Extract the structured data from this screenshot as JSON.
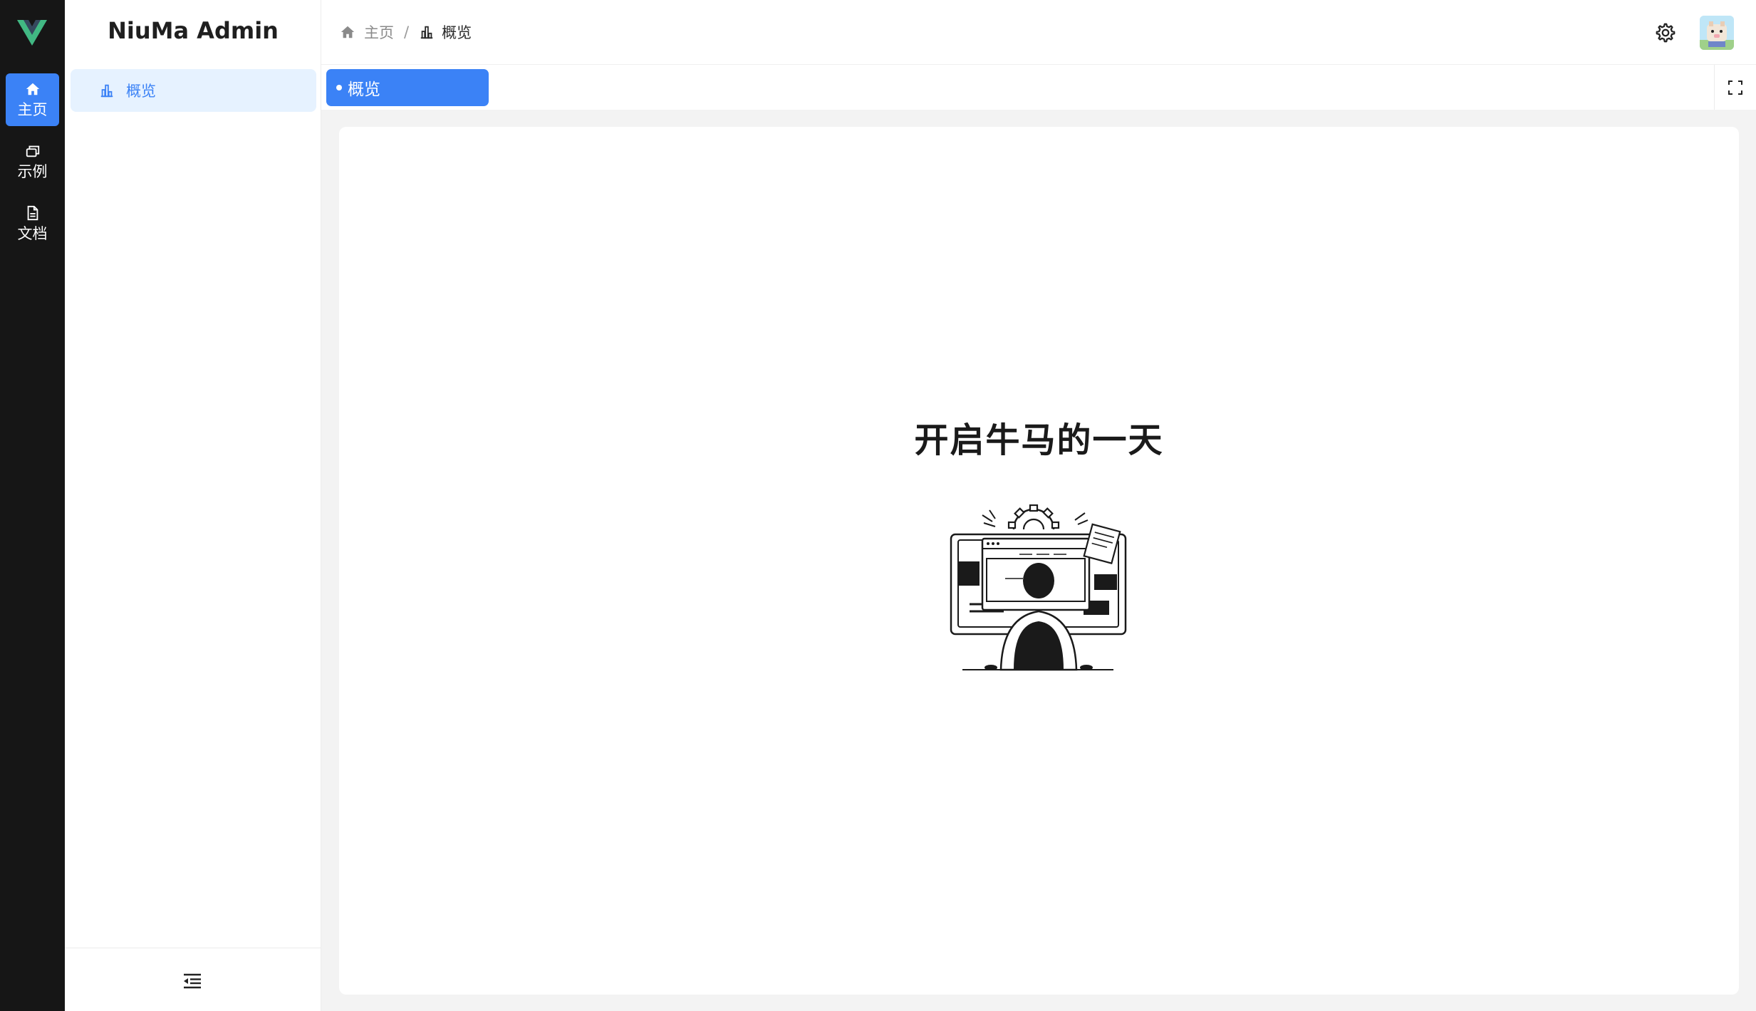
{
  "app": {
    "title": "NiuMa Admin",
    "accent_color": "#3b82f6",
    "logo_icon": "vue-logo-icon"
  },
  "rail": {
    "items": [
      {
        "label": "主页",
        "icon": "home-icon",
        "active": true
      },
      {
        "label": "示例",
        "icon": "windows-icon",
        "active": false
      },
      {
        "label": "文档",
        "icon": "document-icon",
        "active": false
      }
    ]
  },
  "sidebar": {
    "items": [
      {
        "label": "概览",
        "icon": "bar-chart-icon",
        "active": true
      }
    ],
    "collapse_icon": "collapse-menu-icon"
  },
  "header": {
    "breadcrumb": [
      {
        "label": "主页",
        "icon": "home-icon"
      },
      {
        "label": "概览",
        "icon": "bar-chart-icon"
      }
    ],
    "breadcrumb_separator": "/",
    "settings_icon": "gear-icon",
    "avatar_icon": "avatar-image"
  },
  "tabs": [
    {
      "label": "概览",
      "active": true
    }
  ],
  "tabs_bar": {
    "fullscreen_icon": "fullscreen-icon"
  },
  "main": {
    "heading": "开启牛马的一天",
    "illustration": "person-at-computer-illustration"
  }
}
